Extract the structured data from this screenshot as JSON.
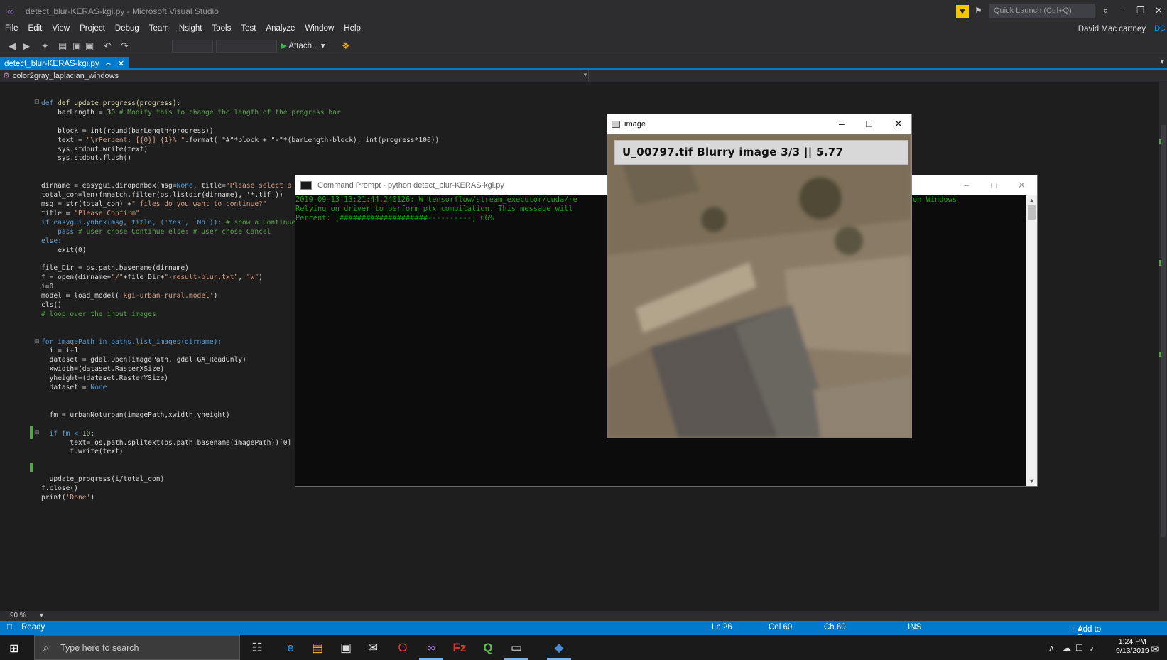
{
  "window": {
    "title": "detect_blur-KERAS-kgi.py - Microsoft Visual Studio",
    "quick_launch": "Quick Launch (Ctrl+Q)",
    "user": "David Mac cartney",
    "user_badge": "DC"
  },
  "menu": [
    "File",
    "Edit",
    "View",
    "Project",
    "Debug",
    "Team",
    "Nsight",
    "Tools",
    "Test",
    "Analyze",
    "Window",
    "Help"
  ],
  "toolbar": {
    "attach_label": "Attach..."
  },
  "tab": {
    "label": "detect_blur-KERAS-kgi.py",
    "pin": "⌢",
    "close": "✕"
  },
  "nav": {
    "scope": "color2gray_laplacian_windows"
  },
  "code": {
    "l1": "def update_progress(progress):",
    "l2a": "    barLength = ",
    "l2b": "30",
    "l2c": " # Modify this to change the length of the progress bar",
    "l3": "    block = int(round(barLength*progress))",
    "l4a": "    text = ",
    "l4b": "\"\\rPercent: [{0}] {1}% \"",
    "l4c": ".format( \"#\"*block + \"-\"*(barLength-block), int(progress*100))",
    "l5": "    sys.stdout.write(text)",
    "l6": "    sys.stdout.flush()",
    "l7a": "dirname = easygui.diropenbox(msg=",
    "l7b": "None",
    "l7c": ", title=",
    "l7d": "\"Please select a dir",
    "l8": "total_con=len(fnmatch.filter(os.listdir(dirname), '*.tif'))",
    "l9a": "msg = str(total_con) +",
    "l9b": "\" files do you want to continue?\"",
    "l10a": "title = ",
    "l10b": "\"Please Confirm\"",
    "l11a": "if easygui.ynbox(msg, title, ('Yes', 'No')): ",
    "l11b": "# show a Continue/Ca",
    "l12a": "    pass ",
    "l12b": "# user chose Continue else: # user chose Cancel",
    "l13": "else:",
    "l14": "    exit(0)",
    "l15": "file_Dir = os.path.basename(dirname)",
    "l16a": "f = open(dirname+",
    "l16b": "\"/\"",
    "l16c": "+file_Dir+",
    "l16d": "\"-result-blur.txt\"",
    "l16e": ", ",
    "l16f": "\"w\"",
    "l16g": ")",
    "l17": "i=0",
    "l18a": "model = load_model(",
    "l18b": "'kgi-urban-rural.model'",
    "l18c": ")",
    "l19": "cls()",
    "l20": "# loop over the input images",
    "l21": "for imagePath in paths.list_images(dirname):",
    "l22": "  i = i+1",
    "l23": "  dataset = gdal.Open(imagePath, gdal.GA_ReadOnly)",
    "l24": "  xwidth=(dataset.RasterXSize)",
    "l25": "  yheight=(dataset.RasterYSize)",
    "l26a": "  dataset = ",
    "l26b": "None",
    "l27": "  fm = urbanNoturban(imagePath,xwidth,yheight)",
    "l28a": "  if fm < ",
    "l28b": "10",
    "l28c": ":",
    "l29": "       text= os.path.splitext(os.path.basename(imagePath))[0] + \"",
    "l30": "       f.write(text)",
    "l31": "  update_progress(i/total_con)",
    "l32": "f.close()",
    "l33a": "print(",
    "l33b": "'Done'",
    "l33c": ")"
  },
  "zoom": "90 %",
  "status": {
    "ready": "Ready",
    "ln": "Ln 26",
    "col": "Col 60",
    "ch": "Ch 60",
    "ins": "INS",
    "source_control": "Add to Source Control"
  },
  "cmd": {
    "title": "Command Prompt - python  detect_blur-KERAS-kgi.py",
    "line1": "2019-09-13 13:21:44.240126: W tensorflow/stream_executor/cuda/re",
    "line2": "Relying on driver to perform ptx compilation. This message will",
    "line3": "Percent: [####################----------] 66%",
    "line1_tail": "on Windows"
  },
  "image_window": {
    "title": "image",
    "caption": "U_00797.tif  Blurry image 3/3  || 5.77"
  },
  "taskbar": {
    "search_placeholder": "Type here to search",
    "time": "1:24 PM",
    "date": "9/13/2019"
  },
  "colors": {
    "accent": "#007acc",
    "editor_bg": "#1e1e1e",
    "console_text": "#13a10e"
  }
}
